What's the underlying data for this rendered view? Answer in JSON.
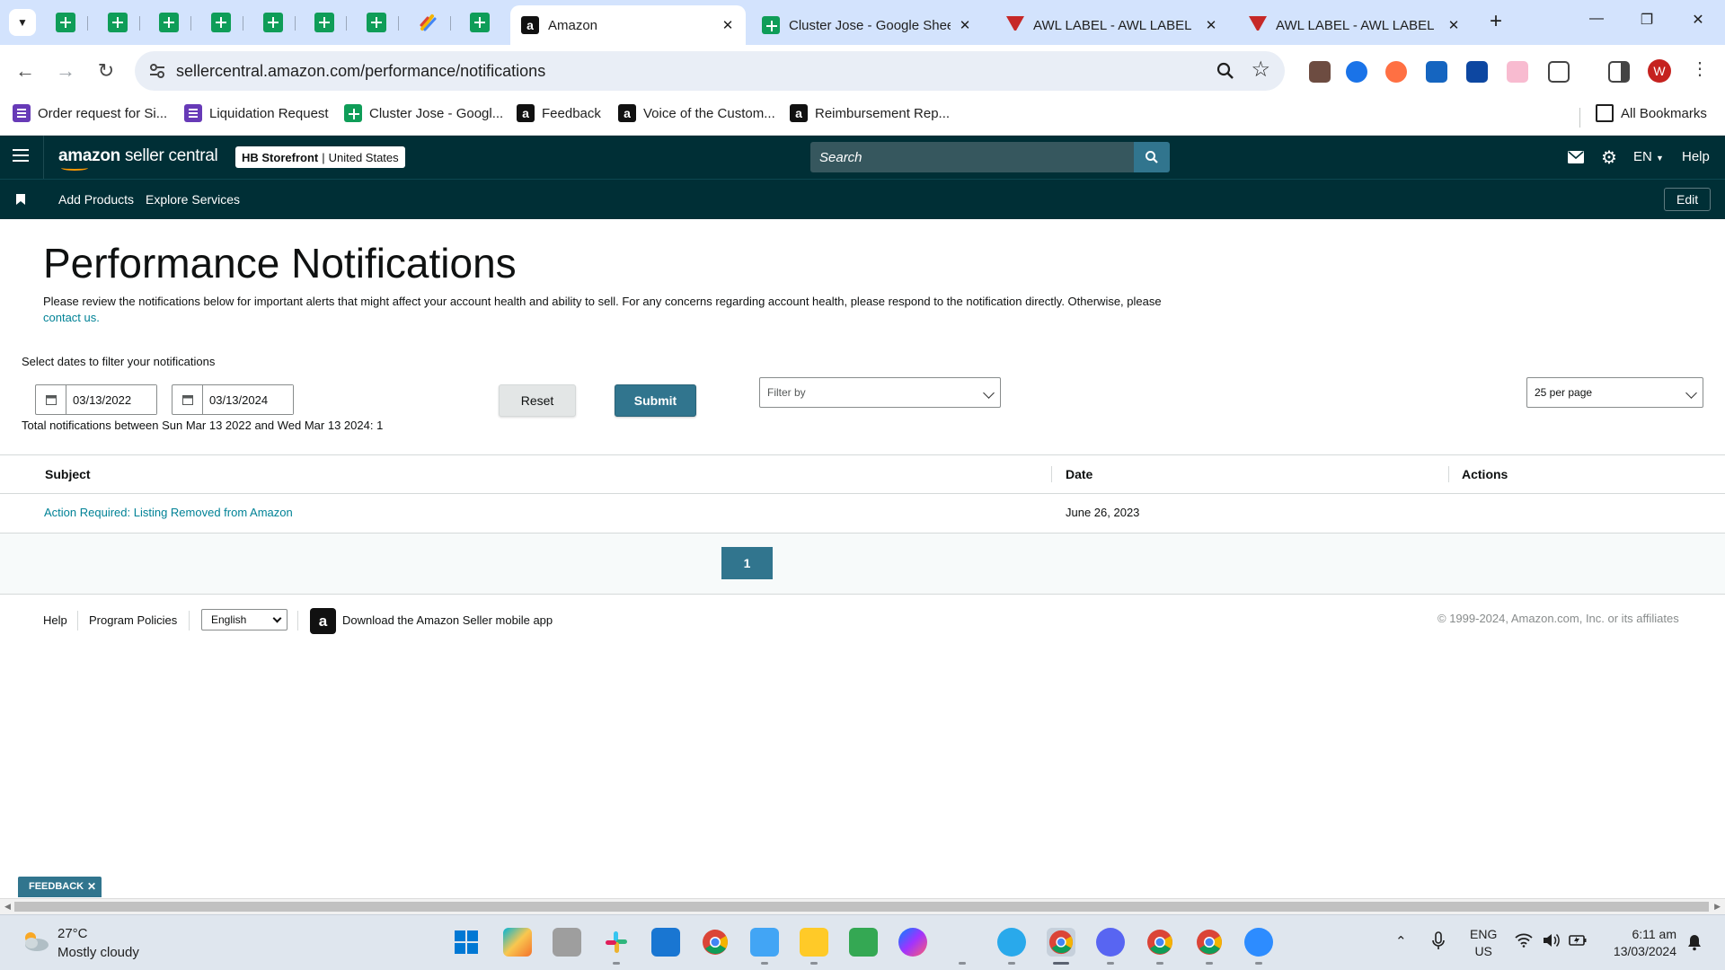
{
  "browser": {
    "tabs": [
      {
        "label": "Amazon",
        "active": true
      },
      {
        "label": "Cluster Jose - Google Sheets"
      },
      {
        "label": "AWL LABEL - AWL LABEL"
      },
      {
        "label": "AWL LABEL - AWL LABEL"
      }
    ],
    "url": "sellercentral.amazon.com/performance/notifications",
    "profile_initial": "W",
    "bookmarks": [
      {
        "label": "Order request for Si..."
      },
      {
        "label": "Liquidation Request"
      },
      {
        "label": "Cluster Jose - Googl..."
      },
      {
        "label": "Feedback"
      },
      {
        "label": "Voice of the Custom..."
      },
      {
        "label": "Reimbursement Rep..."
      }
    ],
    "all_bookmarks": "All Bookmarks"
  },
  "header": {
    "logo_primary": "amazon",
    "logo_secondary": "seller central",
    "store_name": "HB Storefront",
    "store_region": "United States",
    "search_placeholder": "Search",
    "language": "EN",
    "help": "Help"
  },
  "subnav": {
    "items": [
      "Add Products",
      "Explore Services"
    ],
    "edit": "Edit"
  },
  "page": {
    "title": "Performance Notifications",
    "description": "Please review the notifications below for important alerts that might affect your account health and ability to sell. For any concerns regarding account health, please respond to the notification directly. Otherwise, please",
    "contact_link": "contact us.",
    "filter_label": "Select dates to filter your notifications",
    "date_from": "03/13/2022",
    "date_to": "03/13/2024",
    "reset": "Reset",
    "submit": "Submit",
    "filter_by": "Filter by",
    "per_page": "25 per page",
    "total": "Total notifications between Sun Mar 13 2022 and Wed Mar 13 2024: 1"
  },
  "table": {
    "columns": [
      "Subject",
      "Date",
      "Actions"
    ],
    "rows": [
      {
        "subject": "Action Required: Listing Removed from Amazon",
        "date": "June 26, 2023",
        "actions": ""
      }
    ]
  },
  "pagination": {
    "current": "1"
  },
  "footer": {
    "help": "Help",
    "policies": "Program Policies",
    "language": "English",
    "app": "Download the Amazon Seller mobile app",
    "copyright": "© 1999-2024, Amazon.com, Inc. or its affiliates"
  },
  "feedback": "FEEDBACK",
  "taskbar": {
    "temperature": "27°C",
    "weather": "Mostly cloudy",
    "lang_line1": "ENG",
    "lang_line2": "US",
    "time": "6:11 am",
    "date": "13/03/2024"
  },
  "colors": {
    "header_bg": "#002f36",
    "accent": "#31758e",
    "link": "#008296"
  }
}
